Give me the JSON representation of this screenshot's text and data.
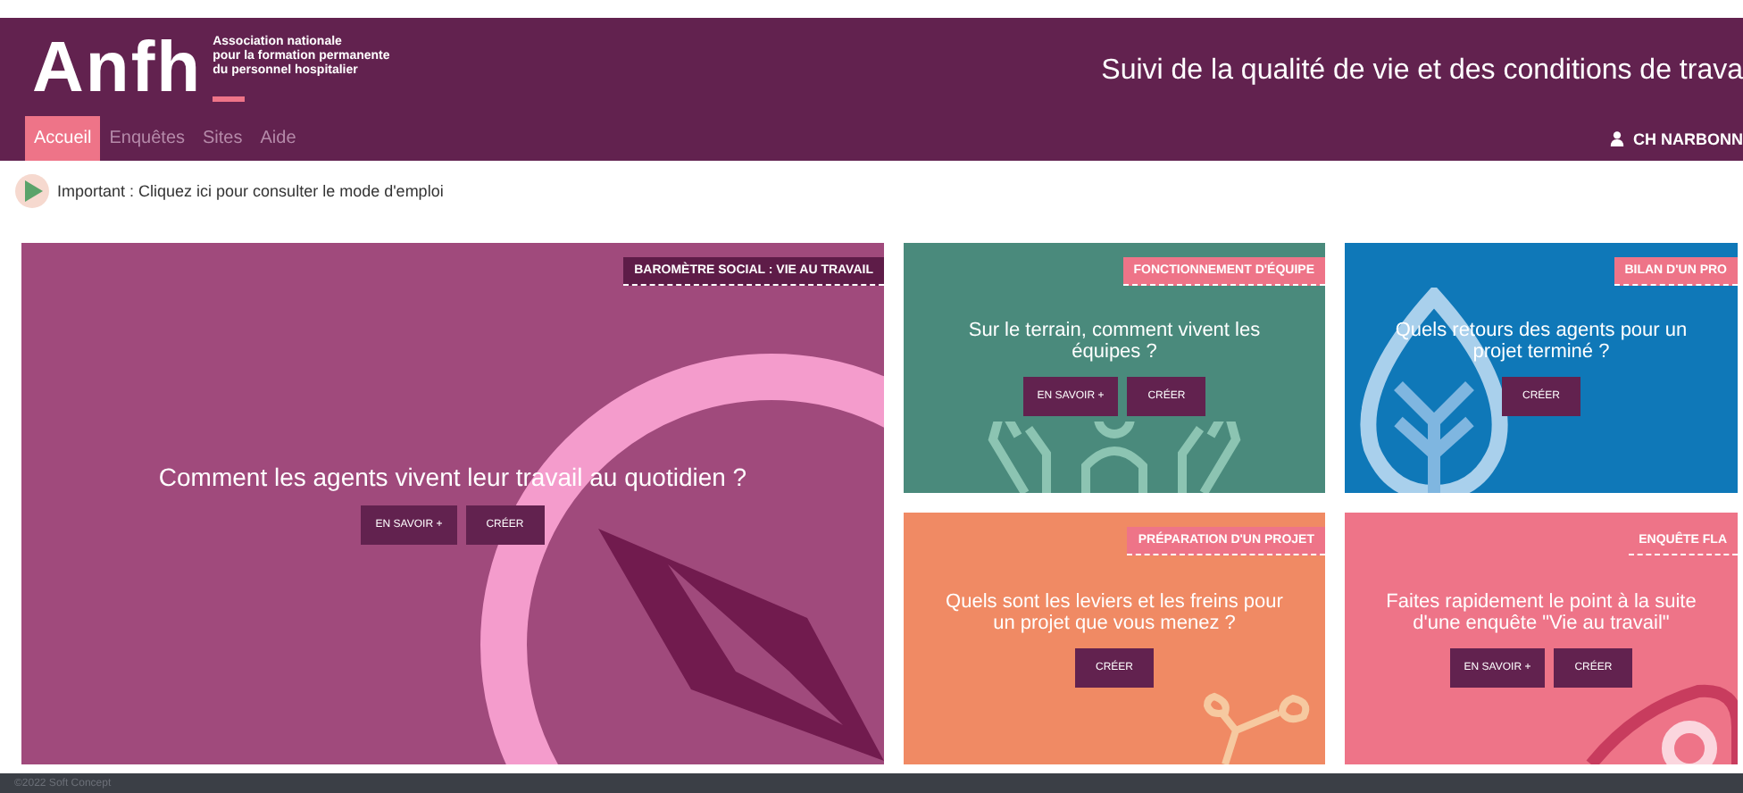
{
  "header": {
    "logo": "Anfh",
    "org_lines": [
      "Association nationale",
      "pour la formation permanente",
      "du personnel hospitalier"
    ],
    "title": "Suivi de la qualité de vie et des conditions de trava",
    "user": "CH NARBONN"
  },
  "nav": [
    {
      "label": "Accueil",
      "selected": true
    },
    {
      "label": "Enquêtes",
      "selected": false
    },
    {
      "label": "Sites",
      "selected": false
    },
    {
      "label": "Aide",
      "selected": false
    }
  ],
  "help_link": "Important : Cliquez ici pour consulter le mode d'emploi",
  "cards": [
    {
      "kind": "compass",
      "color": "#a04a7c",
      "tag": "BAROMÈTRE SOCIAL : VIE AU TRAVAIL",
      "question": "Comment les agents vivent leur travail au quotidien ?",
      "buttons": [
        "EN SAVOIR +",
        "CRÉER"
      ]
    },
    {
      "kind": "hands",
      "color": "#4a8a7c",
      "tag": "FONCTIONNEMENT D'ÉQUIPE",
      "question": "Sur le terrain, comment vivent les équipes ?",
      "buttons": [
        "EN SAVOIR +",
        "CRÉER"
      ]
    },
    {
      "kind": "leaf",
      "color": "#0f78b8",
      "tag": "BILAN D'UN PRO",
      "question": "Quels retours des agents pour un projet terminé ?",
      "buttons": [
        "CRÉER"
      ]
    },
    {
      "kind": "sprout",
      "color": "#f08a64",
      "tag": "PRÉPARATION D'UN PROJET",
      "question": "Quels sont les leviers et les freins pour un projet que vous menez ?",
      "buttons": [
        "CRÉER"
      ]
    },
    {
      "kind": "eye",
      "color": "#ee7488",
      "tag": "ENQUÊTE FLA",
      "question": "Faites rapidement le point à la suite d'une enquête \"Vie au travail\"",
      "buttons": [
        "EN SAVOIR +",
        "CRÉER"
      ]
    }
  ],
  "footer": "©2022 Soft Concept"
}
